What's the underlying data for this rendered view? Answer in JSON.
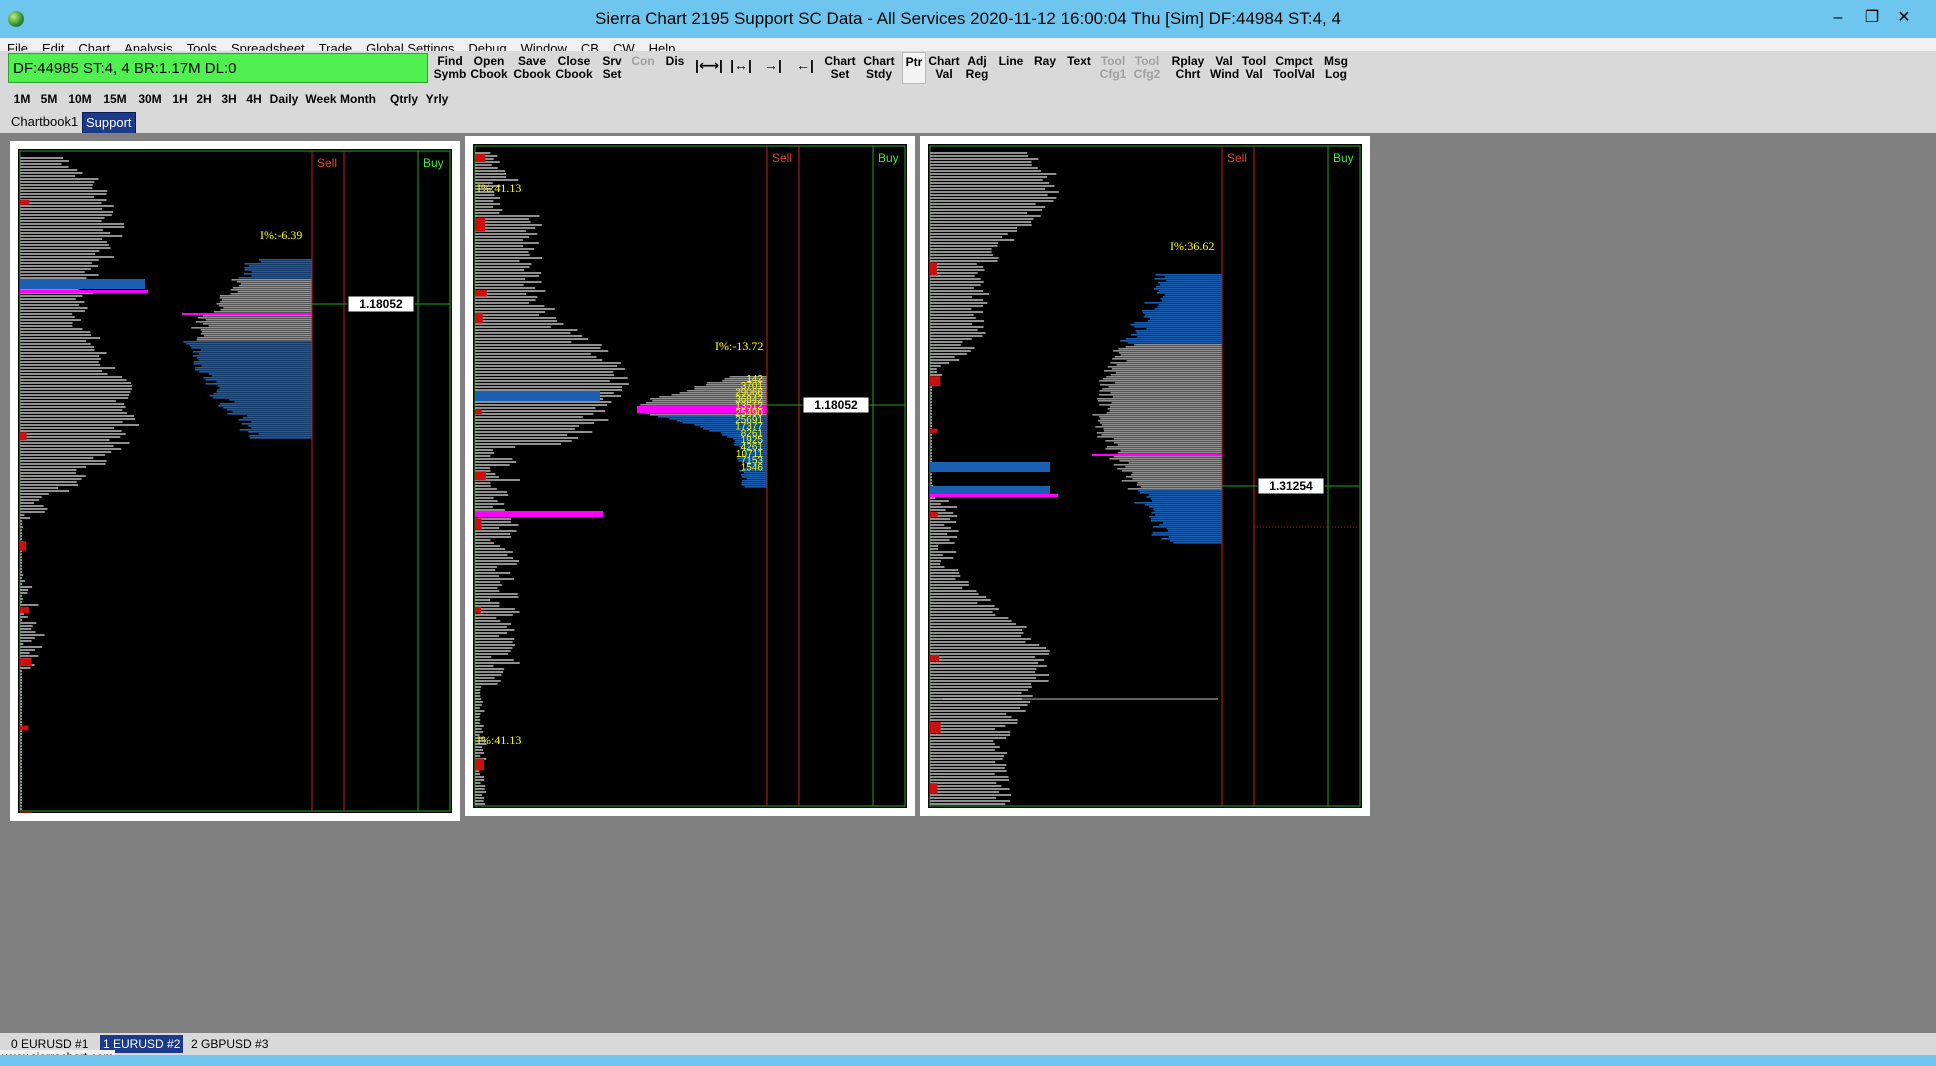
{
  "window": {
    "title": "Sierra Chart 2195 Support  SC Data - All Services 2020-11-12  16:00:04 Thu [Sim]  DF:44984  ST:4, 4"
  },
  "menu": [
    "File",
    "Edit",
    "Chart",
    "Analysis",
    "Tools",
    "Spreadsheet",
    "Trade",
    "Global Settings",
    "Debug",
    "Window",
    "CB",
    "CW",
    "Help"
  ],
  "status_box": "DF:44985  ST:4, 4  BR:1.17M  DL:0",
  "toolbar": [
    {
      "l1": "Find",
      "l2": "Symb",
      "state": "normal"
    },
    {
      "l1": "Open",
      "l2": "Cbook",
      "state": "normal"
    },
    {
      "l1": "Save",
      "l2": "Cbook",
      "state": "normal"
    },
    {
      "l1": "Close",
      "l2": "Cbook",
      "state": "normal"
    },
    {
      "l1": "Srv",
      "l2": "Set",
      "state": "normal"
    },
    {
      "l1": "Con",
      "l2": "",
      "state": "disabled"
    },
    {
      "l1": "Dis",
      "l2": "",
      "state": "normal"
    },
    {
      "l1": "|⟷|",
      "l2": "",
      "state": "icon"
    },
    {
      "l1": "|↔|",
      "l2": "",
      "state": "icon"
    },
    {
      "l1": "→|←",
      "l2": "",
      "state": "icon"
    },
    {
      "l1": "←|→",
      "l2": "",
      "state": "icon"
    },
    {
      "l1": "Chart",
      "l2": "Set",
      "state": "normal"
    },
    {
      "l1": "Chart",
      "l2": "Stdy",
      "state": "normal"
    },
    {
      "l1": "Ptr",
      "l2": "",
      "state": "selected"
    },
    {
      "l1": "Chart",
      "l2": "Val",
      "state": "normal"
    },
    {
      "l1": "Adj",
      "l2": "Reg",
      "state": "normal"
    },
    {
      "l1": "Line",
      "l2": "",
      "state": "normal"
    },
    {
      "l1": "Ray",
      "l2": "",
      "state": "normal"
    },
    {
      "l1": "Text",
      "l2": "",
      "state": "normal"
    },
    {
      "l1": "Tool",
      "l2": "Cfg1",
      "state": "disabled"
    },
    {
      "l1": "Tool",
      "l2": "Cfg2",
      "state": "disabled"
    },
    {
      "l1": "Rplay",
      "l2": "Chrt",
      "state": "normal"
    },
    {
      "l1": "Val",
      "l2": "Wind",
      "state": "normal"
    },
    {
      "l1": "Tool",
      "l2": "Val",
      "state": "normal"
    },
    {
      "l1": "Cmpct",
      "l2": "ToolVal",
      "state": "normal"
    },
    {
      "l1": "Msg",
      "l2": "Log",
      "state": "normal"
    }
  ],
  "timeframes": [
    "1M",
    "5M",
    "10M",
    "15M",
    "30M",
    "1H",
    "2H",
    "3H",
    "4H",
    "Daily",
    "Week",
    "Month",
    "Qtrly",
    "Yrly"
  ],
  "chartbook_tabs": [
    {
      "label": "Chartbook1",
      "active": false
    },
    {
      "label": "Support",
      "active": true
    }
  ],
  "charts": [
    {
      "sell_label": "Sell",
      "buy_label": "Buy",
      "price_label": "1.18052",
      "annotations": [
        {
          "text": "I%:-6.39",
          "pos": "mid"
        }
      ],
      "numbers": []
    },
    {
      "sell_label": "Sell",
      "buy_label": "Buy",
      "price_label": "1.18052",
      "annotations": [
        {
          "text": "I%:41.13",
          "pos": "top"
        },
        {
          "text": "I%:-13.72",
          "pos": "mid"
        },
        {
          "text": "I%:41.13",
          "pos": "bottom"
        }
      ],
      "numbers": [
        "142",
        "3701",
        "29066",
        "36842",
        "13512",
        "25490",
        "25691",
        "17377",
        "8261",
        "1925",
        "4261",
        "10711",
        "7153",
        "1546"
      ]
    },
    {
      "sell_label": "Sell",
      "buy_label": "Buy",
      "price_label": "1.31254",
      "annotations": [
        {
          "text": "I%:36.62",
          "pos": "mid"
        }
      ],
      "numbers": []
    }
  ],
  "bottom_tabs": [
    {
      "label": "0 EURUSD  #1",
      "active": false
    },
    {
      "label": "1 EURUSD  #2",
      "active": true
    },
    {
      "label": "2 GBPUSD  #3",
      "active": false
    }
  ],
  "url": "www.sierrachart.com",
  "colors": {
    "sell_line": "#c02020",
    "buy_line": "#20a020",
    "profile_gray": "#909090",
    "profile_blue": "#1a5fb0",
    "poc": "#ff00ff",
    "annotation": "#ffff00"
  }
}
